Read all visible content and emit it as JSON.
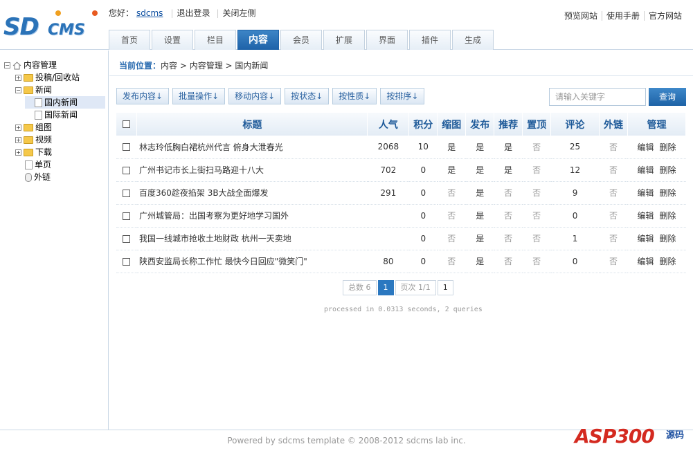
{
  "logo": {
    "text": "SDCMS",
    "part1": "SD",
    "part2": "CMS"
  },
  "userbar": {
    "greeting": "您好：",
    "username": "sdcms",
    "logout": "退出登录",
    "close_left": "关闭左侧"
  },
  "top_links": [
    "预览网站",
    "使用手册",
    "官方网站"
  ],
  "nav": [
    "首页",
    "设置",
    "栏目",
    "内容",
    "会员",
    "扩展",
    "界面",
    "插件",
    "生成"
  ],
  "nav_active_index": 3,
  "tree": {
    "root": "内容管理",
    "items": [
      "投稿/回收站",
      "新闻",
      "国内新闻",
      "国际新闻",
      "组图",
      "视频",
      "下载",
      "单页",
      "外链"
    ]
  },
  "breadcrumb": {
    "label": "当前位置：",
    "path": "内容 > 内容管理 > 国内新闻"
  },
  "toolbar": [
    "发布内容↓",
    "批量操作↓",
    "移动内容↓",
    "按状态↓",
    "按性质↓",
    "按排序↓"
  ],
  "search": {
    "placeholder": "请输入关键字",
    "button": "查询"
  },
  "table": {
    "headers": [
      "标题",
      "人气",
      "积分",
      "缩图",
      "发布",
      "推荐",
      "置顶",
      "评论",
      "外链",
      "管理"
    ],
    "rows": [
      {
        "title": "林志玲低胸白裙杭州代言 俯身大泄春光",
        "hits": "2068",
        "score": "10",
        "thumb": "是",
        "publish": "是",
        "recommend": "是",
        "top": "否",
        "comments": "25",
        "link": "否"
      },
      {
        "title": "广州书记市长上街扫马路迎十八大",
        "hits": "702",
        "score": "0",
        "thumb": "是",
        "publish": "是",
        "recommend": "是",
        "top": "否",
        "comments": "12",
        "link": "否"
      },
      {
        "title": "百度360趁夜掐架 3B大战全面爆发",
        "hits": "291",
        "score": "0",
        "thumb": "否",
        "publish": "是",
        "recommend": "否",
        "top": "否",
        "comments": "9",
        "link": "否"
      },
      {
        "title": "广州城管局：出国考察为更好地学习国外",
        "hits": "",
        "score": "0",
        "thumb": "否",
        "publish": "是",
        "recommend": "否",
        "top": "否",
        "comments": "0",
        "link": "否"
      },
      {
        "title": "我国一线城市抢收土地财政 杭州一天卖地",
        "hits": "",
        "score": "0",
        "thumb": "否",
        "publish": "是",
        "recommend": "否",
        "top": "否",
        "comments": "1",
        "link": "否"
      },
      {
        "title": "陕西安监局长称工作忙 最快今日回应\"微笑门\"",
        "hits": "80",
        "score": "0",
        "thumb": "否",
        "publish": "是",
        "recommend": "否",
        "top": "否",
        "comments": "0",
        "link": "否"
      }
    ],
    "ops": [
      "编辑",
      "删除"
    ]
  },
  "pager": {
    "total": "总数 6",
    "current": "1",
    "pages": "页次 1/1",
    "page_link": "1"
  },
  "processed": "processed in 0.0313 seconds, 2 queries",
  "footer": "Powered by sdcms template © 2008-2012 sdcms lab inc.",
  "watermark": {
    "main": "ASP300",
    "sub": "源码"
  },
  "colors": {
    "accent": "#2b73b8",
    "nav_active": "#1e62a8",
    "table_header_text": "#1e5a99"
  }
}
